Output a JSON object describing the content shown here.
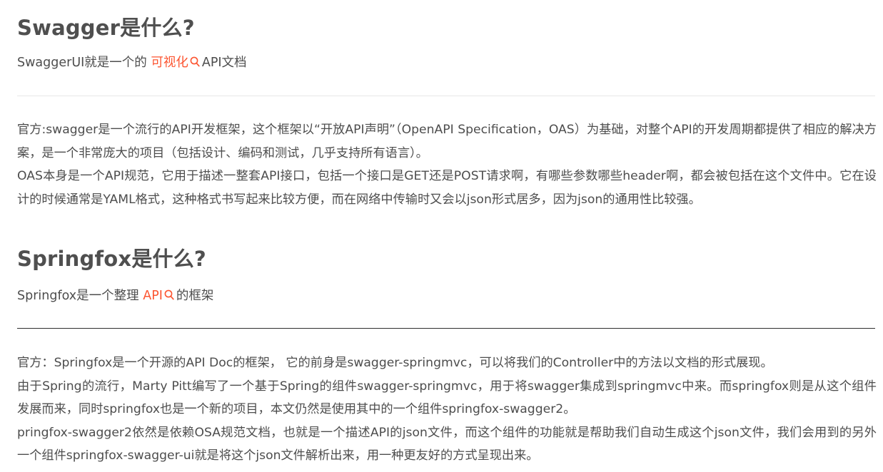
{
  "sections": {
    "swagger": {
      "heading": "Swagger是什么?",
      "intro_prefix": "SwaggerUI就是一个的 ",
      "intro_link": "可视化",
      "intro_suffix": "API文档",
      "paragraphs": [
        "官方:swagger是一个流行的API开发框架，这个框架以“开放API声明”（OpenAPI Specification，OAS）为基础，对整个API的开发周期都提供了相应的解决方案，是一个非常庞大的项目（包括设计、编码和测试，几乎支持所有语言）。",
        "OAS本身是一个API规范，它用于描述一整套API接口，包括一个接口是GET还是POST请求啊，有哪些参数哪些header啊，都会被包括在这个文件中。它在设计的时候通常是YAML格式，这种格式书写起来比较方便，而在网络中传输时又会以json形式居多，因为json的通用性比较强。"
      ]
    },
    "springfox": {
      "heading": "Springfox是什么?",
      "intro_prefix": "Springfox是一个整理 ",
      "intro_link": "API",
      "intro_suffix": "的框架",
      "paragraphs": [
        "官方：Springfox是一个开源的API Doc的框架， 它的前身是swagger-springmvc，可以将我们的Controller中的方法以文档的形式展现。",
        "由于Spring的流行，Marty Pitt编写了一个基于Spring的组件swagger-springmvc，用于将swagger集成到springmvc中来。而springfox则是从这个组件发展而来，同时springfox也是一个新的项目，本文仍然是使用其中的一个组件springfox-swagger2。",
        "pringfox-swagger2依然是依赖OSA规范文档，也就是一个描述API的json文件，而这个组件的功能就是帮助我们自动生成这个json文件，我们会用到的另外一个组件springfox-swagger-ui就是将这个json文件解析出来，用一种更友好的方式呈现出来。"
      ]
    }
  },
  "colors": {
    "link": "#fc5531",
    "text": "#4d4d4d",
    "heading": "#4f4f4f"
  },
  "icons": {
    "search": "magnifier-icon"
  }
}
